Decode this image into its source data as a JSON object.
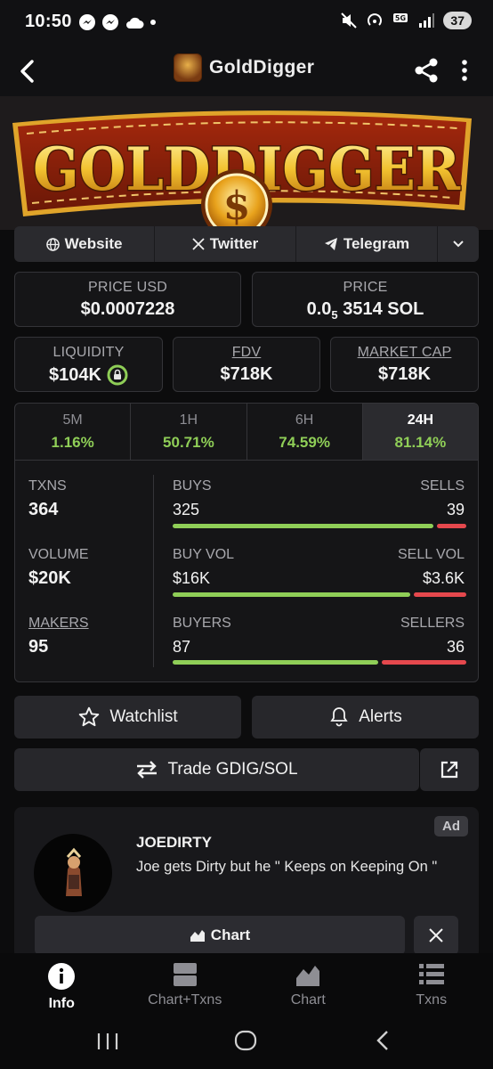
{
  "status_bar": {
    "time": "10:50",
    "battery": "37"
  },
  "header": {
    "title": "GoldDigger"
  },
  "banner": {
    "wordmark": "GOLDDIGGER",
    "emblem": "$"
  },
  "links": {
    "website": "Website",
    "twitter": "Twitter",
    "telegram": "Telegram"
  },
  "price": {
    "usd_label": "PRICE USD",
    "usd_value": "$0.0007228",
    "native_label": "PRICE",
    "native_prefix": "0.0",
    "native_sub": "5",
    "native_rest": "3514 SOL"
  },
  "metrics": {
    "liquidity_label": "LIQUIDITY",
    "liquidity_value": "$104K",
    "fdv_label": "FDV",
    "fdv_value": "$718K",
    "mcap_label": "MARKET CAP",
    "mcap_value": "$718K"
  },
  "timeframes": [
    {
      "label": "5M",
      "value": "1.16%"
    },
    {
      "label": "1H",
      "value": "50.71%"
    },
    {
      "label": "6H",
      "value": "74.59%"
    },
    {
      "label": "24H",
      "value": "81.14%"
    }
  ],
  "stats": {
    "txns_label": "TXNS",
    "txns_value": "364",
    "volume_label": "VOLUME",
    "volume_value": "$20K",
    "makers_label": "MAKERS",
    "makers_value": "95",
    "buys_label": "BUYS",
    "buys_value": "325",
    "sells_label": "SELLS",
    "sells_value": "39",
    "buyvol_label": "BUY VOL",
    "buyvol_value": "$16K",
    "sellvol_label": "SELL VOL",
    "sellvol_value": "$3.6K",
    "buyers_label": "BUYERS",
    "buyers_value": "87",
    "sellers_label": "SELLERS",
    "sellers_value": "36",
    "buy_fraction": 0.893,
    "buyvol_fraction": 0.816,
    "buyers_fraction": 0.707
  },
  "actions": {
    "watchlist": "Watchlist",
    "alerts": "Alerts",
    "trade": "Trade GDIG/SOL"
  },
  "ad": {
    "badge": "Ad",
    "name": "JOEDIRTY",
    "description": "Joe gets Dirty but he \" Keeps on Keeping On \"",
    "chart_button": "Chart"
  },
  "bottom_nav": [
    {
      "label": "Info"
    },
    {
      "label": "Chart+Txns"
    },
    {
      "label": "Chart"
    },
    {
      "label": "Txns"
    }
  ],
  "colors": {
    "green": "#8fce57",
    "red": "#e5484d",
    "gold": "#f2b01e"
  }
}
